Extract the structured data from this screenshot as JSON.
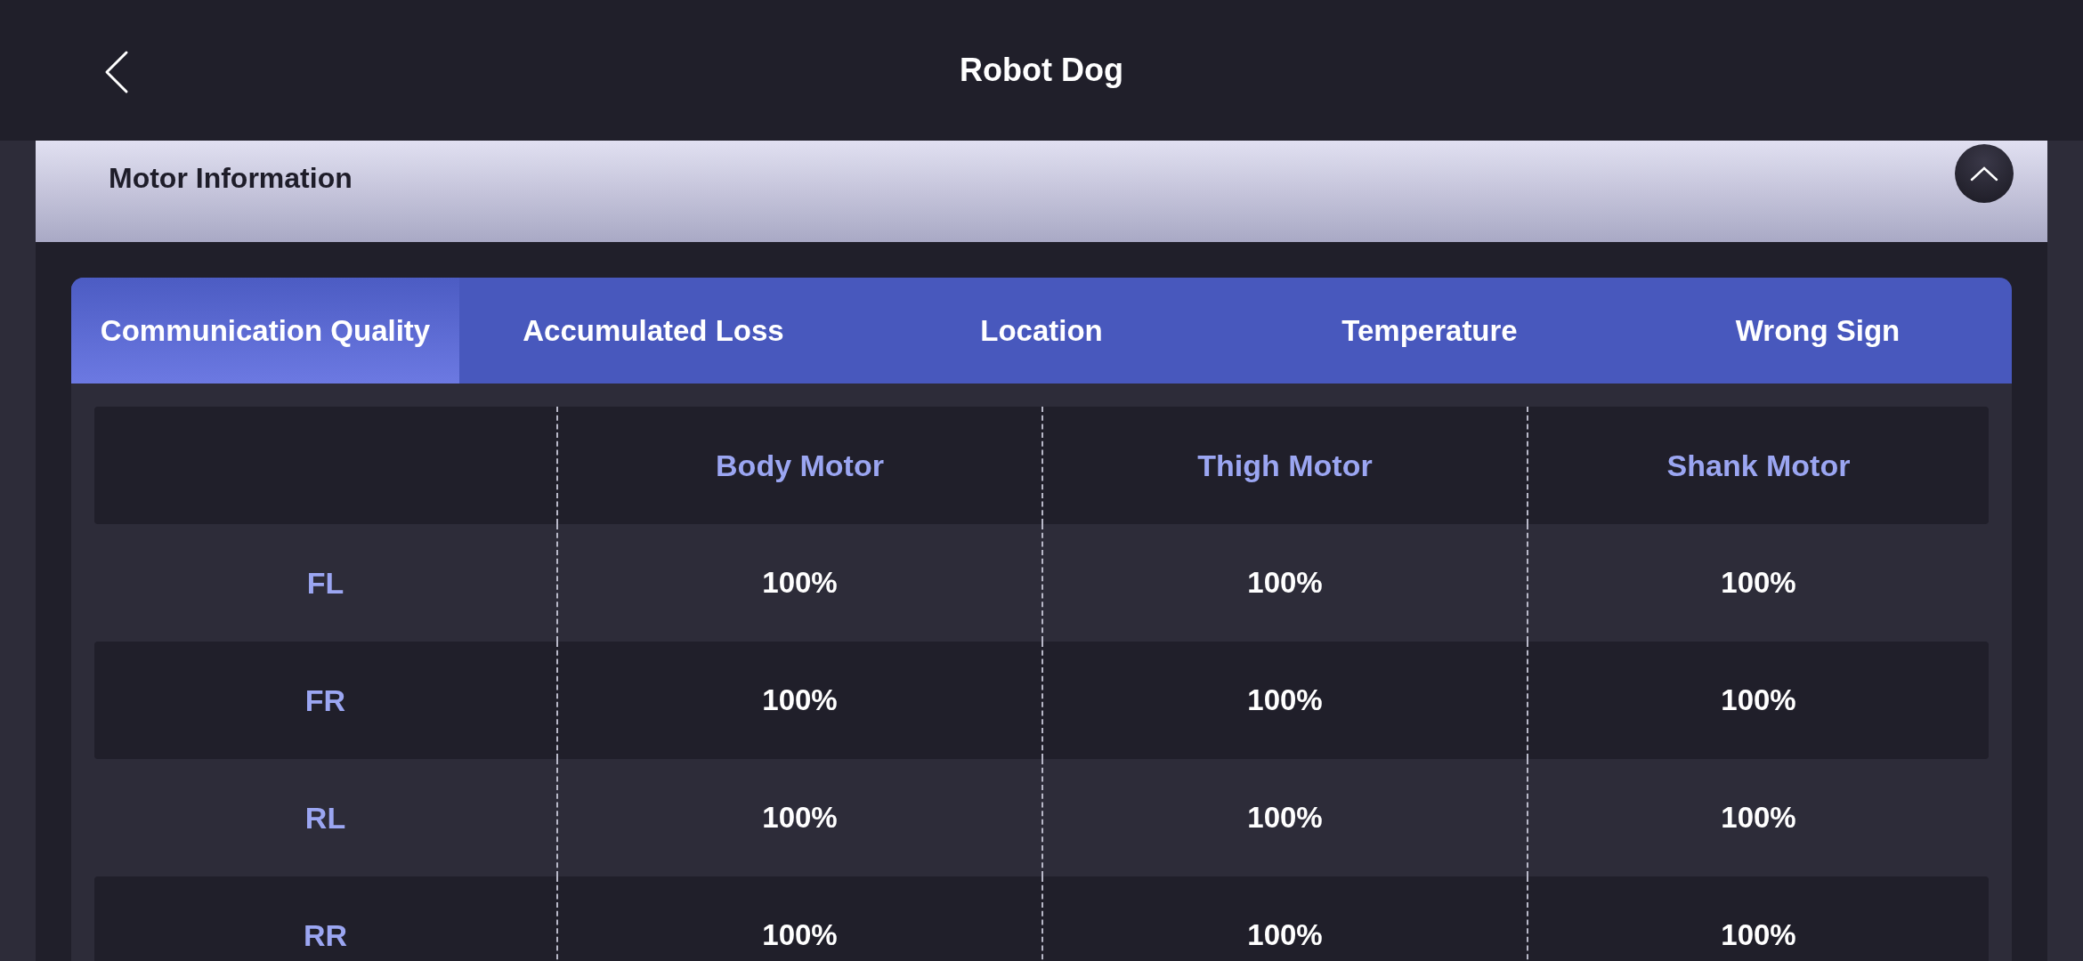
{
  "header": {
    "title": "Robot Dog"
  },
  "section": {
    "title": "Motor Information",
    "expanded": true
  },
  "tabs": [
    {
      "label": "Communication Quality",
      "selected": true
    },
    {
      "label": "Accumulated Loss",
      "selected": false
    },
    {
      "label": "Location",
      "selected": false
    },
    {
      "label": "Temperature",
      "selected": false
    },
    {
      "label": "Wrong Sign",
      "selected": false
    }
  ],
  "table": {
    "columns": [
      "Body Motor",
      "Thigh Motor",
      "Shank Motor"
    ],
    "rows": [
      {
        "leg": "FL",
        "values": [
          "100%",
          "100%",
          "100%"
        ]
      },
      {
        "leg": "FR",
        "values": [
          "100%",
          "100%",
          "100%"
        ]
      },
      {
        "leg": "RL",
        "values": [
          "100%",
          "100%",
          "100%"
        ]
      },
      {
        "leg": "RR",
        "values": [
          "100%",
          "100%",
          "100%"
        ]
      }
    ]
  }
}
